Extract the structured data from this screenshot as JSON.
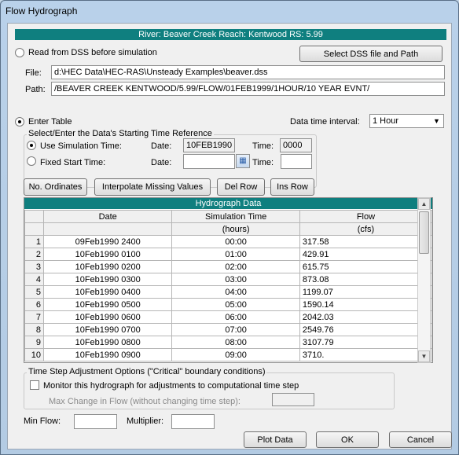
{
  "window": {
    "title": "Flow Hydrograph"
  },
  "banner": "River: Beaver Creek  Reach: Kentwood  RS: 5.99",
  "dss": {
    "read_label": "Read from DSS before simulation",
    "select_button": "Select DSS file and Path",
    "file_label": "File:",
    "file_value": "d:\\HEC Data\\HEC-RAS\\Unsteady Examples\\beaver.dss",
    "path_label": "Path:",
    "path_value": "/BEAVER CREEK KENTWOOD/5.99/FLOW/01FEB1999/1HOUR/10 YEAR EVNT/"
  },
  "enter_table": {
    "label": "Enter Table",
    "interval_label": "Data time interval:",
    "interval_value": "1 Hour"
  },
  "time_ref": {
    "group_label": "Select/Enter the Data's Starting Time Reference",
    "use_sim_label": "Use Simulation Time:",
    "date_label": "Date:",
    "time_label": "Time:",
    "sim_date": "10FEB1990",
    "sim_time": "0000",
    "fixed_label": "Fixed Start Time:",
    "fixed_date": "",
    "fixed_time": ""
  },
  "buttons": {
    "ordinates": "No. Ordinates",
    "interpolate": "Interpolate Missing Values",
    "del_row": "Del Row",
    "ins_row": "Ins Row",
    "plot": "Plot Data",
    "ok": "OK",
    "cancel": "Cancel"
  },
  "grid": {
    "title": "Hydrograph Data",
    "headers": [
      "Date",
      "Simulation Time",
      "Flow"
    ],
    "units": [
      "",
      "(hours)",
      "(cfs)"
    ],
    "rows": [
      {
        "n": "1",
        "date": "09Feb1990 2400",
        "time": "00:00",
        "flow": "317.58"
      },
      {
        "n": "2",
        "date": "10Feb1990 0100",
        "time": "01:00",
        "flow": "429.91"
      },
      {
        "n": "3",
        "date": "10Feb1990 0200",
        "time": "02:00",
        "flow": "615.75"
      },
      {
        "n": "4",
        "date": "10Feb1990 0300",
        "time": "03:00",
        "flow": "873.08"
      },
      {
        "n": "5",
        "date": "10Feb1990 0400",
        "time": "04:00",
        "flow": "1199.07"
      },
      {
        "n": "6",
        "date": "10Feb1990 0500",
        "time": "05:00",
        "flow": "1590.14"
      },
      {
        "n": "7",
        "date": "10Feb1990 0600",
        "time": "06:00",
        "flow": "2042.03"
      },
      {
        "n": "8",
        "date": "10Feb1990 0700",
        "time": "07:00",
        "flow": "2549.76"
      },
      {
        "n": "9",
        "date": "10Feb1990 0800",
        "time": "08:00",
        "flow": "3107.79"
      },
      {
        "n": "10",
        "date": "10Feb1990 0900",
        "time": "09:00",
        "flow": "3710."
      }
    ]
  },
  "adjust": {
    "group_label": "Time Step Adjustment Options (\"Critical\" boundary conditions)",
    "monitor_label": "Monitor this hydrograph for adjustments to computational time step",
    "max_change_label": "Max Change in Flow (without changing time step):",
    "max_change_value": ""
  },
  "bottom": {
    "min_flow_label": "Min Flow:",
    "min_flow_value": "",
    "multiplier_label": "Multiplier:",
    "multiplier_value": ""
  }
}
